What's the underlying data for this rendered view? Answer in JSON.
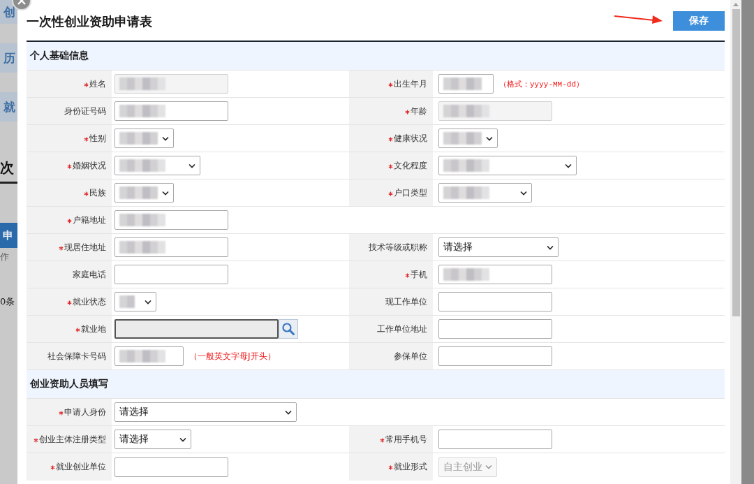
{
  "background_page": {
    "nav_items": [
      "创",
      "历",
      "就"
    ],
    "heading": "次",
    "tab": "申",
    "text": "作",
    "count": "0条"
  },
  "dialog": {
    "title": "一次性创业资助申请表",
    "save_button": "保存",
    "sections": [
      {
        "title": "个人基础信息",
        "rows": [
          {
            "cells": [
              {
                "kind": "field",
                "label": "姓名",
                "required": true,
                "field": {
                  "kind": "text",
                  "redacted": true,
                  "disabled": true
                }
              },
              {
                "kind": "field",
                "label": "出生年月",
                "required": true,
                "field": {
                  "kind": "text",
                  "redacted": true,
                  "disabled": false
                },
                "hint": "（格式：yyyy-MM-dd）"
              }
            ]
          },
          {
            "cells": [
              {
                "kind": "field",
                "label": "身份证号码",
                "required": false,
                "field": {
                  "kind": "text",
                  "redacted": true,
                  "disabled": false
                }
              },
              {
                "kind": "field",
                "label": "年龄",
                "required": true,
                "field": {
                  "kind": "text",
                  "redacted": true,
                  "disabled": true
                }
              }
            ]
          },
          {
            "cells": [
              {
                "kind": "field",
                "label": "性别",
                "required": true,
                "field": {
                  "kind": "select",
                  "redacted": true,
                  "disabled": false
                }
              },
              {
                "kind": "field",
                "label": "健康状况",
                "required": true,
                "field": {
                  "kind": "select",
                  "redacted": true,
                  "disabled": false
                }
              }
            ]
          },
          {
            "cells": [
              {
                "kind": "field",
                "label": "婚姻状况",
                "required": true,
                "field": {
                  "kind": "select",
                  "redacted": true,
                  "disabled": false
                }
              },
              {
                "kind": "field",
                "label": "文化程度",
                "required": true,
                "field": {
                  "kind": "select",
                  "redacted": true,
                  "disabled": false
                }
              }
            ]
          },
          {
            "cells": [
              {
                "kind": "field",
                "label": "民族",
                "required": true,
                "field": {
                  "kind": "select",
                  "redacted": true,
                  "disabled": false
                }
              },
              {
                "kind": "field",
                "label": "户口类型",
                "required": true,
                "field": {
                  "kind": "select",
                  "redacted": true,
                  "disabled": false
                }
              }
            ]
          },
          {
            "cells": [
              {
                "kind": "field",
                "label": "户籍地址",
                "required": true,
                "field": {
                  "kind": "text",
                  "redacted": true,
                  "disabled": false
                }
              },
              {
                "kind": "blank"
              }
            ]
          },
          {
            "cells": [
              {
                "kind": "field",
                "label": "现居住地址",
                "required": true,
                "field": {
                  "kind": "text",
                  "redacted": true,
                  "disabled": false
                }
              },
              {
                "kind": "field",
                "label": "技术等级或职称",
                "required": false,
                "field": {
                  "kind": "select",
                  "value": "请选择",
                  "redacted": false,
                  "disabled": false
                }
              }
            ]
          },
          {
            "cells": [
              {
                "kind": "field",
                "label": "家庭电话",
                "required": false,
                "field": {
                  "kind": "text",
                  "redacted": false,
                  "disabled": false
                }
              },
              {
                "kind": "field",
                "label": "手机",
                "required": true,
                "field": {
                  "kind": "text",
                  "redacted": true,
                  "disabled": false
                }
              }
            ]
          },
          {
            "cells": [
              {
                "kind": "field",
                "label": "就业状态",
                "required": true,
                "field": {
                  "kind": "select",
                  "redacted": true,
                  "disabled": false
                }
              },
              {
                "kind": "field",
                "label": "现工作单位",
                "required": false,
                "field": {
                  "kind": "text",
                  "redacted": false,
                  "disabled": false
                }
              }
            ]
          },
          {
            "cells": [
              {
                "kind": "field",
                "label": "就业地",
                "required": true,
                "field": {
                  "kind": "search",
                  "redacted": false,
                  "disabled": true
                }
              },
              {
                "kind": "field",
                "label": "工作单位地址",
                "required": false,
                "field": {
                  "kind": "text",
                  "redacted": false,
                  "disabled": false
                }
              }
            ]
          },
          {
            "cells": [
              {
                "kind": "field",
                "label": "社会保障卡号码",
                "required": false,
                "field": {
                  "kind": "text",
                  "redacted": true,
                  "disabled": false
                },
                "hint": "（一般英文字母J开头）"
              },
              {
                "kind": "field",
                "label": "参保单位",
                "required": false,
                "field": {
                  "kind": "text",
                  "redacted": false,
                  "disabled": false
                }
              }
            ]
          }
        ]
      },
      {
        "title": "创业资助人员填写",
        "rows": [
          {
            "cells": [
              {
                "kind": "field",
                "label": "申请人身份",
                "required": true,
                "field": {
                  "kind": "select",
                  "value": "请选择",
                  "redacted": false,
                  "disabled": false
                }
              },
              {
                "kind": "blank"
              }
            ]
          },
          {
            "cells": [
              {
                "kind": "field",
                "label": "创业主体注册类型",
                "required": true,
                "field": {
                  "kind": "select",
                  "value": "请选择",
                  "redacted": false,
                  "disabled": false
                }
              },
              {
                "kind": "field",
                "label": "常用手机号",
                "required": true,
                "field": {
                  "kind": "text",
                  "redacted": false,
                  "disabled": false
                }
              }
            ]
          },
          {
            "cells": [
              {
                "kind": "field",
                "label": "就业创业单位",
                "required": true,
                "field": {
                  "kind": "text",
                  "redacted": false,
                  "disabled": false
                }
              },
              {
                "kind": "field",
                "label": "就业形式",
                "required": true,
                "field": {
                  "kind": "select",
                  "value": "自主创业",
                  "redacted": false,
                  "disabled": true
                }
              }
            ]
          }
        ]
      }
    ]
  }
}
